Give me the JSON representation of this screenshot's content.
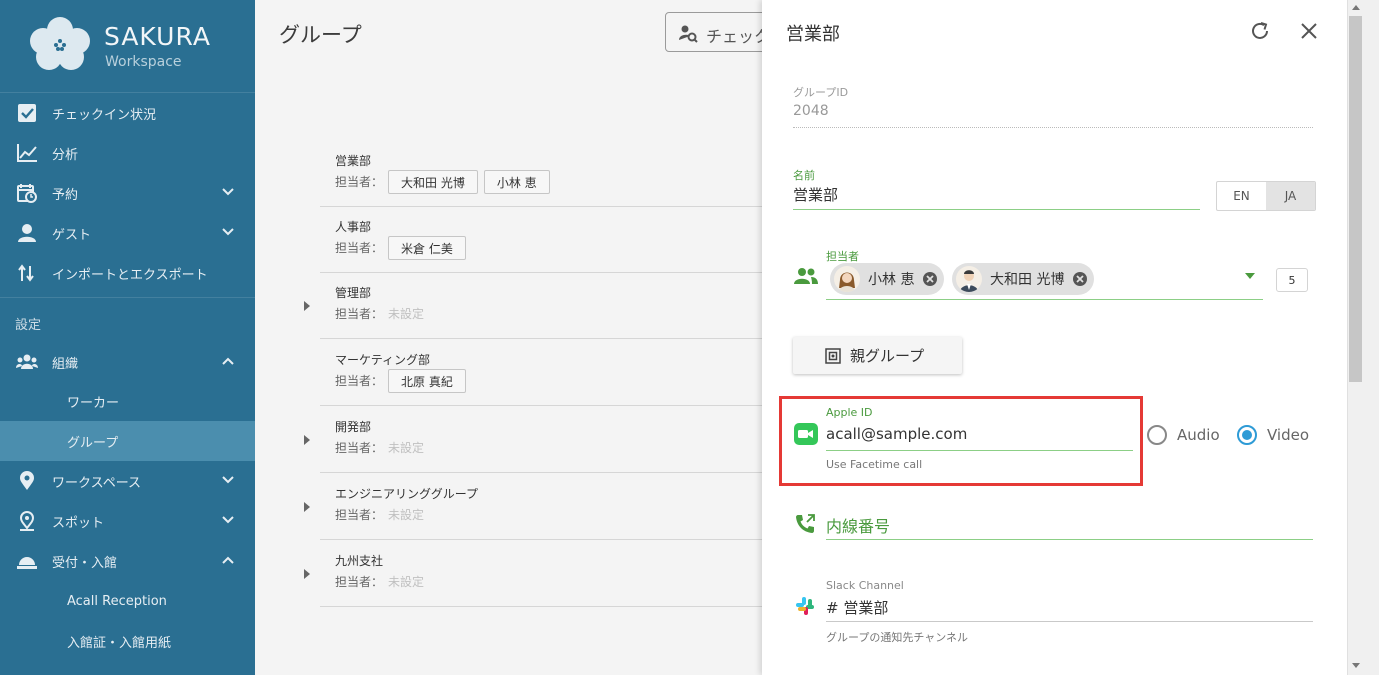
{
  "brand": {
    "title": "SAKURA",
    "subtitle": "Workspace"
  },
  "sidebar": {
    "items": [
      {
        "label": "チェックイン状況"
      },
      {
        "label": "分析"
      },
      {
        "label": "予約"
      },
      {
        "label": "ゲスト"
      },
      {
        "label": "インポートとエクスポート"
      }
    ],
    "settings_label": "設定",
    "org": {
      "label": "組織",
      "children": [
        "ワーカー",
        "グループ"
      ]
    },
    "workspace_label": "ワークスペース",
    "spot_label": "スポット",
    "reception": {
      "label": "受付・入館",
      "children": [
        "Acall Reception",
        "入館証・入館用紙"
      ]
    }
  },
  "main": {
    "title": "グループ",
    "checkin_button": "チェック",
    "manager_prefix": "担当者：",
    "unset_text": "未設定",
    "groups": [
      {
        "name": "営業部",
        "managers": [
          "大和田 光博",
          "小林 恵"
        ],
        "expandable": false
      },
      {
        "name": "人事部",
        "managers": [
          "米倉 仁美"
        ],
        "expandable": false
      },
      {
        "name": "管理部",
        "managers": [],
        "expandable": true
      },
      {
        "name": "マーケティング部",
        "managers": [
          "北原 真紀"
        ],
        "expandable": false
      },
      {
        "name": "開発部",
        "managers": [],
        "expandable": true
      },
      {
        "name": "エンジニアリンググループ",
        "managers": [],
        "expandable": true
      },
      {
        "name": "九州支社",
        "managers": [],
        "expandable": true
      }
    ]
  },
  "panel": {
    "title": "営業部",
    "group_id_label": "グループID",
    "group_id": "2048",
    "name_label": "名前",
    "name_value": "営業部",
    "lang_en": "EN",
    "lang_ja": "JA",
    "managers_label": "担当者",
    "managers": [
      "小林 恵",
      "大和田 光博"
    ],
    "manager_count": "5",
    "parent_group_button": "親グループ",
    "apple_id_label": "Apple ID",
    "apple_id_value": "acall@sample.com",
    "facetime_hint": "Use Facetime call",
    "audio_label": "Audio",
    "video_label": "Video",
    "selected_call_mode": "Video",
    "extension_label": "内線番号",
    "slack_label": "Slack Channel",
    "slack_value": "# 営業部",
    "slack_hint": "グループの通知先チャンネル"
  },
  "colors": {
    "sidebar": "#2a6f92",
    "sidebar_active": "#4b8eae",
    "accent_green": "#4a9a3e",
    "radio_blue": "#2e9bd6",
    "highlight_red": "#e53935"
  }
}
